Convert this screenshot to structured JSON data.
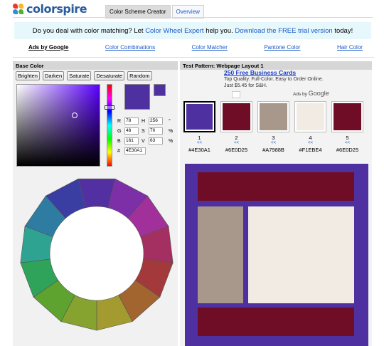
{
  "header": {
    "logo_text": "colorspire",
    "tabs": [
      {
        "label": "Color Scheme Creator"
      },
      {
        "label": "Overview"
      }
    ]
  },
  "promo": {
    "before": "Do you deal with color matching? Let ",
    "link1": "Color Wheel Expert",
    "middle": " help you. ",
    "link2": "Download the FREE trial version",
    "after": " today!"
  },
  "ad_links": {
    "ads_by": "Ads by Google",
    "items": [
      "Color Combinations",
      "Color Matcher",
      "Pantone Color",
      "Hair Color"
    ]
  },
  "base_color": {
    "title": "Base Color",
    "buttons": [
      "Brighten",
      "Darken",
      "Saturate",
      "Desaturate",
      "Random"
    ],
    "swatch_color": "#4E30A1",
    "fields": {
      "r_label": "R",
      "r": "78",
      "g_label": "G",
      "g": "48",
      "b_label": "B",
      "b": "161",
      "h_label": "H",
      "h": "256",
      "h_unit": "°",
      "s_label": "S",
      "s": "70",
      "s_unit": "%",
      "v_label": "V",
      "v": "63",
      "v_unit": "%",
      "hex_label": "#",
      "hex": "4E30A1"
    }
  },
  "wheel": {
    "colors": [
      "#5230a1",
      "#7c2fa6",
      "#a1309b",
      "#a33060",
      "#a3393a",
      "#a3652f",
      "#a39b2f",
      "#86a32f",
      "#5ea32f",
      "#2fa35a",
      "#2fa392",
      "#2f7ca3",
      "#3a3ea3"
    ]
  },
  "test_pattern": {
    "title": "Test Pattern: Webpage Layout 1",
    "ad": {
      "title": "250 Free Business Cards",
      "desc": "Top Quality. Full-Color. Easy to Order Online. Just $5.45 for S&H.",
      "ads_by": "Ads by",
      "google": "Google"
    },
    "colors": [
      {
        "num": "1",
        "arrow": "<<",
        "hex": "#4E30A1",
        "color": "#4E30A1"
      },
      {
        "num": "2",
        "arrow": "<<",
        "hex": "#6E0D25",
        "color": "#6E0D25"
      },
      {
        "num": "3",
        "arrow": "<<",
        "hex": "#A7988B",
        "color": "#A7988B"
      },
      {
        "num": "4",
        "arrow": "<<",
        "hex": "#F1EBE4",
        "color": "#F1EBE4"
      },
      {
        "num": "5",
        "arrow": "<<",
        "hex": "#6E0D25",
        "color": "#6E0D25"
      }
    ]
  }
}
